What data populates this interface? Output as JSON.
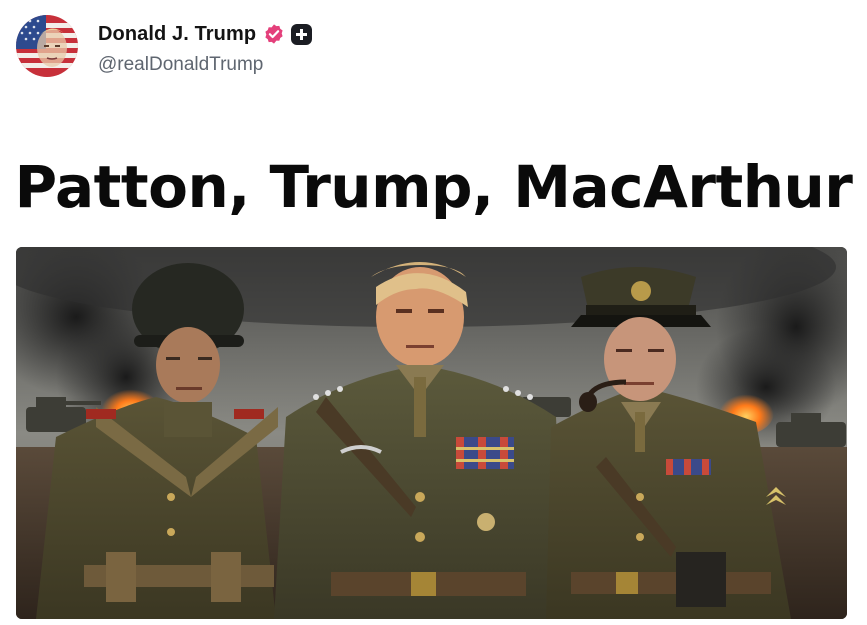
{
  "post": {
    "author": {
      "display_name": "Donald J. Trump",
      "handle": "@realDonaldTrump",
      "avatar_icon": "avatar-flag-portrait",
      "verified_icon": "verified-badge-icon",
      "verified_color": "#e4407b",
      "plus_icon": "plus-badge-icon"
    },
    "headline": "Patton, Trump, MacArthur",
    "image": {
      "description_icon": "three-generals-battlefield-image"
    }
  },
  "colors": {
    "text_primary": "#141414",
    "text_secondary": "#5f6670",
    "background": "#ffffff"
  }
}
